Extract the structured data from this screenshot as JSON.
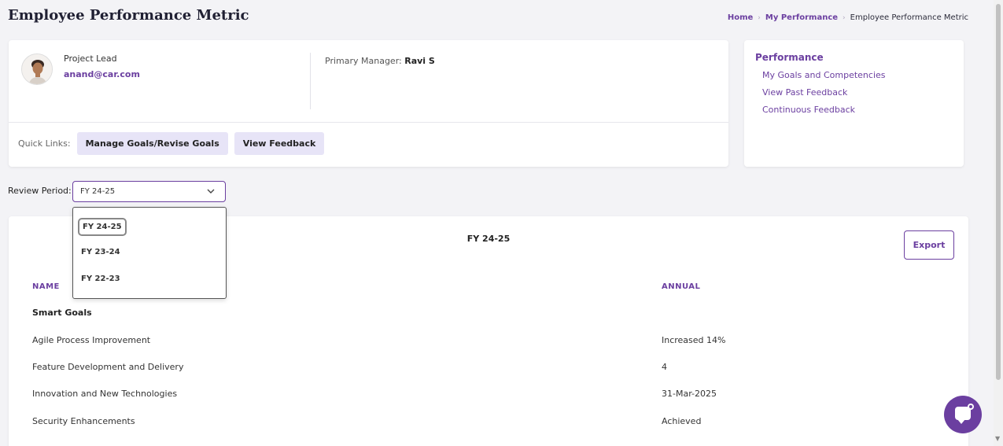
{
  "page": {
    "title": "Employee Performance Metric"
  },
  "breadcrumb": {
    "home": "Home",
    "my_performance": "My Performance",
    "current": "Employee Performance Metric",
    "separator": "›"
  },
  "profile": {
    "role": "Project Lead",
    "email": "anand@car.com",
    "manager_label": "Primary Manager:",
    "manager_name": "Ravi S"
  },
  "quick_links": {
    "label": "Quick Links:",
    "manage_goals": "Manage Goals/Revise Goals",
    "view_feedback": "View Feedback"
  },
  "performance_panel": {
    "title": "Performance",
    "links": [
      "My Goals and Competencies",
      "View Past Feedback",
      "Continuous Feedback"
    ]
  },
  "review_period": {
    "label": "Review Period:",
    "selected": "FY 24-25",
    "options": [
      "FY 24-25",
      "FY 23-24",
      "FY 22-23"
    ]
  },
  "main": {
    "period_title": "FY 24-25",
    "export_label": "Export",
    "headers": {
      "name": "NAME",
      "annual": "ANNUAL"
    },
    "rows": [
      {
        "name": "Smart Goals",
        "annual": ""
      },
      {
        "name": "Agile Process Improvement",
        "annual": "Increased 14%"
      },
      {
        "name": "Feature Development and Delivery",
        "annual": "4"
      },
      {
        "name": "Innovation and New Technologies",
        "annual": "31-Mar-2025"
      },
      {
        "name": "Security Enhancements",
        "annual": "Achieved"
      }
    ]
  },
  "colors": {
    "accent": "#6b3fa0",
    "soft_button": "#e7e4f7"
  },
  "icons": {
    "chevron": "chevron-down-icon",
    "chat": "chat-icon"
  }
}
